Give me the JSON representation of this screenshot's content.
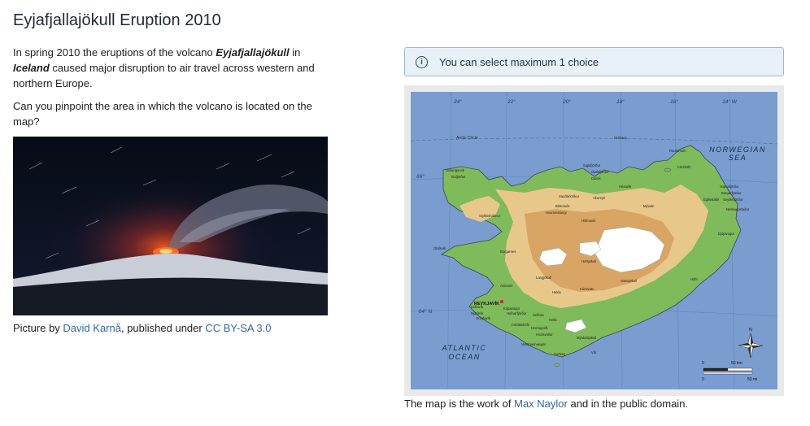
{
  "page": {
    "title": "Eyjafjallajökull Eruption 2010"
  },
  "intro": {
    "text_before": "In spring 2010 the eruptions of the volcano ",
    "volcano_name": "Eyjafjallajökull",
    "text_middle": " in ",
    "country": "Iceland",
    "text_after": " caused major disruption to air travel across western and northern Europe."
  },
  "question": "Can you pinpoint the area in which the volcano is located on the map?",
  "photo_credit": {
    "prefix": "Picture by ",
    "author": "David Karnå",
    "middle": ", published under ",
    "license": "CC BY-SA 3.0"
  },
  "info_box": {
    "icon": "info-icon",
    "text": "You can select maximum 1 choice"
  },
  "map": {
    "longitudes": [
      "24°",
      "22°",
      "20°",
      "18°",
      "16°",
      "14° W"
    ],
    "latitudes": [
      "66°",
      "64° N"
    ],
    "arctic_circle": "Arctic Circle",
    "seas": {
      "north_1": "NORWEGIAN",
      "north_2": "SEA",
      "south_1": "ATLANTIC",
      "south_2": "OCEAN"
    },
    "capital": "REYKJAVÍK",
    "places": [
      "Bolungarvik",
      "Ísafjörður",
      "Siglufjörður",
      "Ólafsfjörður",
      "Dalvík",
      "Húsavík",
      "Akureyri",
      "Sauðárkrókur",
      "Blönduós",
      "Hvammstangi",
      "Grímsey",
      "Raufarhöfn",
      "Þórshöfn",
      "Vopnafjörður",
      "Borgarfjörður",
      "Seyðisfjörður",
      "Egilsstaðir",
      "Neskaupstaður",
      "Djúpivogur",
      "Höfn",
      "Hólmavík",
      "Stykkishólmur",
      "Ólafsvík",
      "Borgarnes",
      "Akranes",
      "Keflavík",
      "Njarðvík",
      "Grindavík",
      "Kópavogur",
      "Hafnarfjörður",
      "Selfoss",
      "Þorlákshöfn",
      "Hveragerði",
      "Hella",
      "Hvolsvöllur",
      "Vík",
      "Vestmannaeyjar",
      "Surtsey",
      "Mýrdalsjökull",
      "Langjökull",
      "Hofsjökull",
      "Vatnajökull",
      "Hekla",
      "Mývatn",
      "Þórisvatn"
    ],
    "scale": {
      "km_zero": "0",
      "km_label": "50 km",
      "mi_zero": "0",
      "mi_label": "50 mi"
    },
    "compass": "N"
  },
  "map_credit": {
    "prefix": "The map is the work of ",
    "author": "Max Naylor",
    "suffix": " and in the public domain."
  }
}
